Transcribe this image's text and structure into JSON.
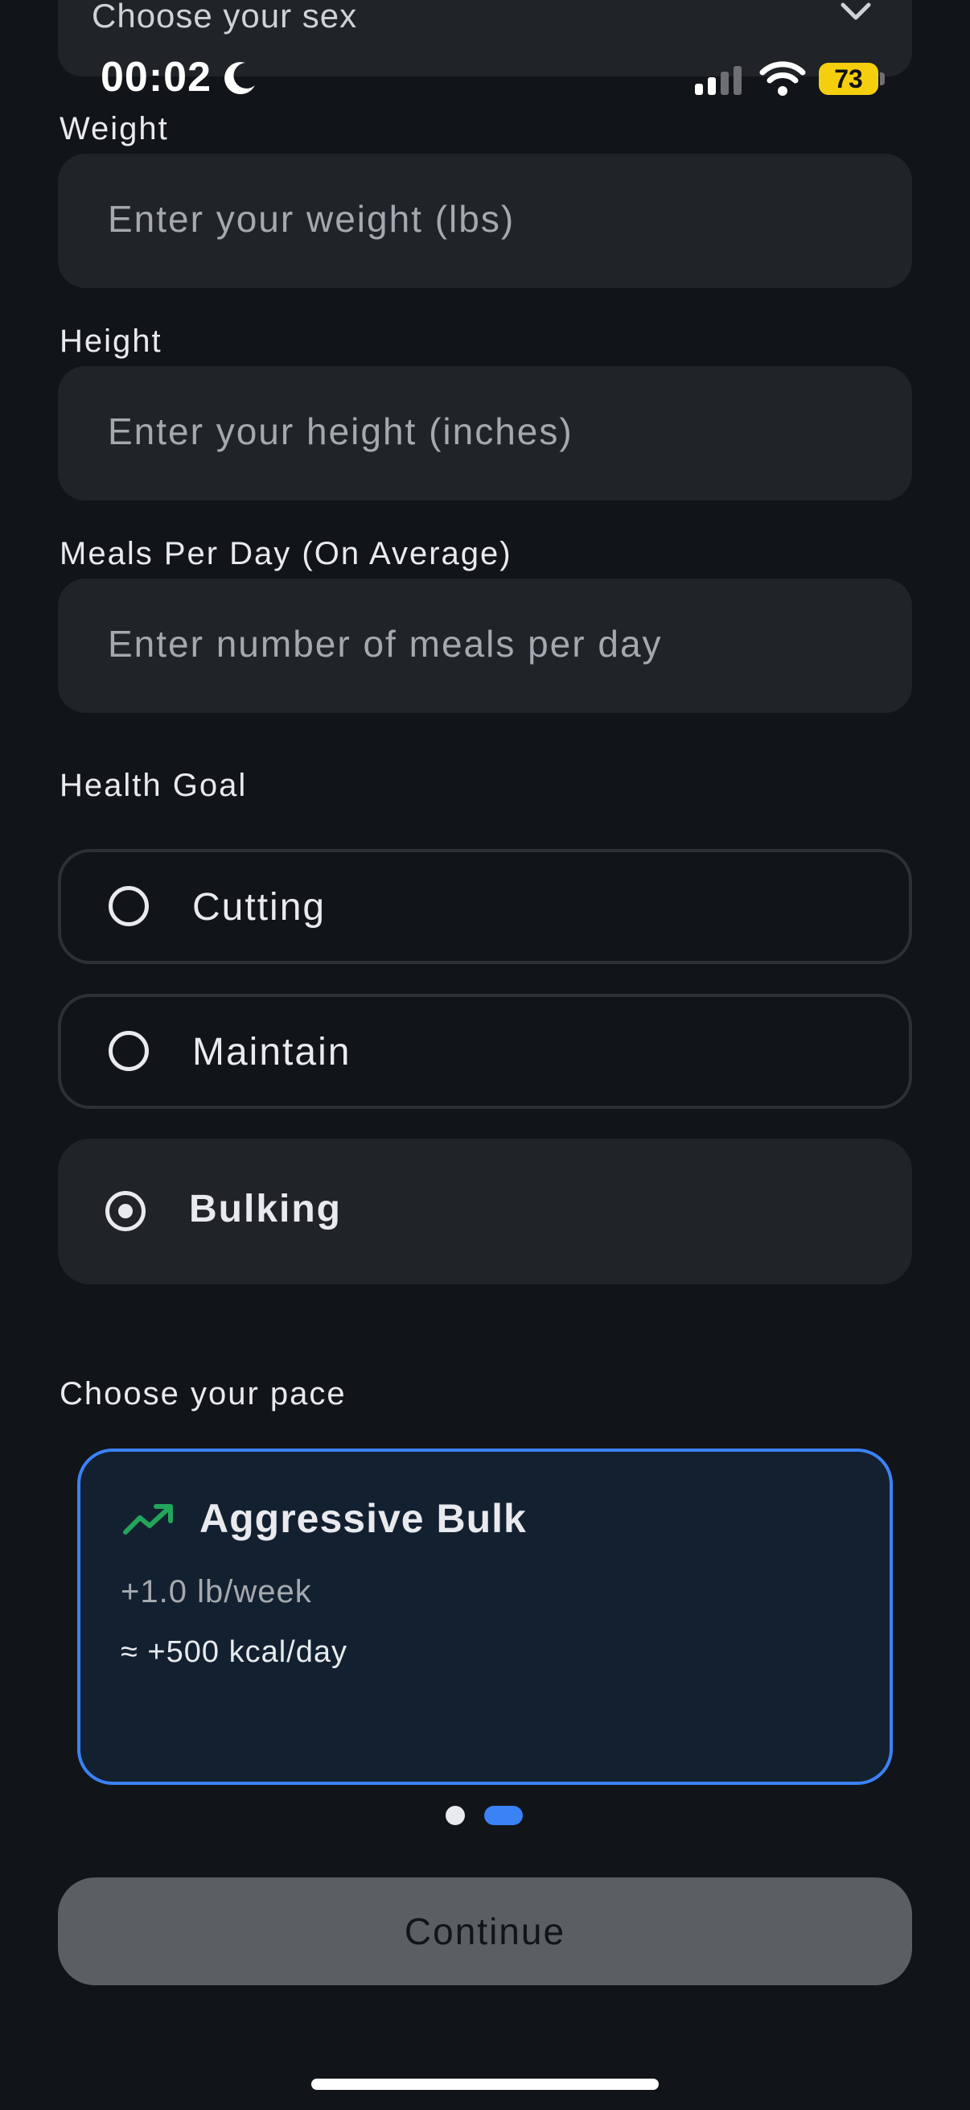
{
  "form": {
    "sex_placeholder": "Choose your sex",
    "weight_label": "Weight",
    "weight_placeholder": "Enter your weight (lbs)",
    "height_label": "Height",
    "height_placeholder": "Enter your height (inches)",
    "meals_label": "Meals Per Day (On Average)",
    "meals_placeholder": "Enter number of meals per day"
  },
  "status_bar": {
    "time": "00:02",
    "battery": "73",
    "icons": [
      "moon-icon",
      "signal-icon",
      "wifi-icon",
      "battery-icon"
    ]
  },
  "health_goal": {
    "label": "Health Goal",
    "options": [
      {
        "label": "Cutting",
        "selected": false
      },
      {
        "label": "Maintain",
        "selected": false
      },
      {
        "label": "Bulking",
        "selected": true
      }
    ]
  },
  "pace": {
    "label": "Choose your pace",
    "card": {
      "title": "Aggressive Bulk",
      "rate": "+1.0 lb/week",
      "kcal": "≈ +500 kcal/day",
      "icon": "trending-up-icon"
    },
    "pagination": {
      "count": 2,
      "active": 2
    }
  },
  "actions": {
    "continue_label": "Continue"
  },
  "colors": {
    "background": "#111418",
    "field": "#202327",
    "accent": "#3b82f6",
    "trend": "#22a55a",
    "battery": "#f5cf0e",
    "button_disabled": "#5b5e62"
  }
}
